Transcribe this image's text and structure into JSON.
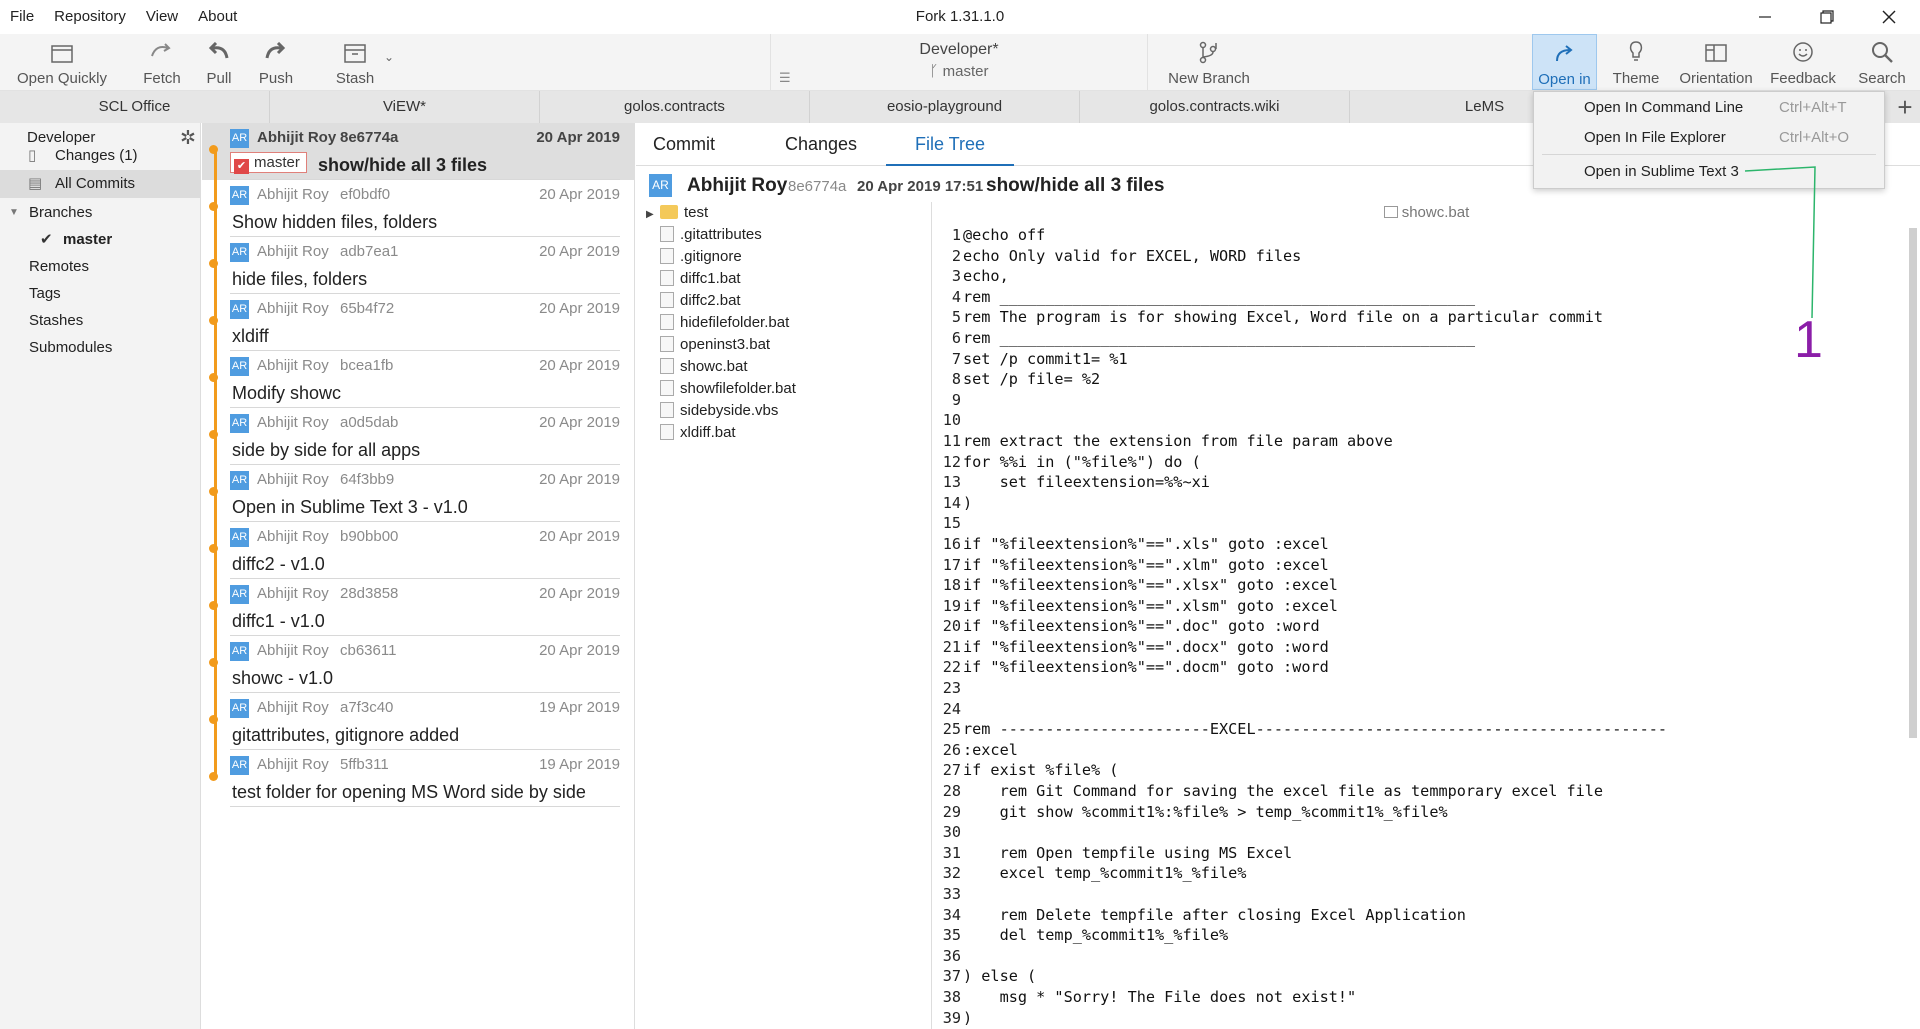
{
  "window": {
    "title": "Fork 1.31.1.0"
  },
  "menu": [
    "File",
    "Repository",
    "View",
    "About"
  ],
  "toolbar": {
    "open_quickly": "Open Quickly",
    "fetch": "Fetch",
    "pull": "Pull",
    "push": "Push",
    "stash": "Stash",
    "repo_name": "Developer*",
    "repo_branch": "master",
    "new_branch": "New Branch",
    "open_in": "Open in",
    "theme": "Theme",
    "orientation": "Orientation",
    "feedback": "Feedback",
    "search": "Search"
  },
  "repo_tabs": [
    "SCL Office",
    "ViEW*",
    "golos.contracts",
    "eosio-playground",
    "golos.contracts.wiki",
    "LeMS"
  ],
  "sidebar": {
    "title": "Developer",
    "changes": "Changes (1)",
    "all_commits": "All Commits",
    "branches": "Branches",
    "master": "master",
    "remotes": "Remotes",
    "tags": "Tags",
    "stashes": "Stashes",
    "submodules": "Submodules"
  },
  "commits": [
    {
      "avatar": "AR",
      "author": "Abhijit Roy",
      "hash": "8e6774a",
      "date": "20 Apr 2019",
      "message": "show/hide all 3 files",
      "branch": "master"
    },
    {
      "avatar": "AR",
      "author": "Abhijit Roy",
      "hash": "ef0bdf0",
      "date": "20 Apr 2019",
      "message": "Show hidden files, folders"
    },
    {
      "avatar": "AR",
      "author": "Abhijit Roy",
      "hash": "adb7ea1",
      "date": "20 Apr 2019",
      "message": "hide files, folders"
    },
    {
      "avatar": "AR",
      "author": "Abhijit Roy",
      "hash": "65b4f72",
      "date": "20 Apr 2019",
      "message": "xldiff"
    },
    {
      "avatar": "AR",
      "author": "Abhijit Roy",
      "hash": "bcea1fb",
      "date": "20 Apr 2019",
      "message": "Modify showc"
    },
    {
      "avatar": "AR",
      "author": "Abhijit Roy",
      "hash": "a0d5dab",
      "date": "20 Apr 2019",
      "message": "side by side for all apps"
    },
    {
      "avatar": "AR",
      "author": "Abhijit Roy",
      "hash": "64f3bb9",
      "date": "20 Apr 2019",
      "message": "Open in Sublime Text 3 - v1.0"
    },
    {
      "avatar": "AR",
      "author": "Abhijit Roy",
      "hash": "b90bb00",
      "date": "20 Apr 2019",
      "message": "diffc2 - v1.0"
    },
    {
      "avatar": "AR",
      "author": "Abhijit Roy",
      "hash": "28d3858",
      "date": "20 Apr 2019",
      "message": "diffc1 - v1.0"
    },
    {
      "avatar": "AR",
      "author": "Abhijit Roy",
      "hash": "cb63611",
      "date": "20 Apr 2019",
      "message": "showc - v1.0"
    },
    {
      "avatar": "AR",
      "author": "Abhijit Roy",
      "hash": "a7f3c40",
      "date": "19 Apr 2019",
      "message": "gitattributes, gitignore added"
    },
    {
      "avatar": "AR",
      "author": "Abhijit Roy",
      "hash": "5ffb311",
      "date": "19 Apr 2019",
      "message": "test folder for opening MS Word side by side"
    }
  ],
  "detail": {
    "tabs": [
      "Commit",
      "Changes",
      "File Tree"
    ],
    "active_tab": "File Tree",
    "avatar": "AR",
    "author": "Abhijit Roy",
    "hash": "8e6774a",
    "date": "20 Apr 2019 17:51",
    "subject": "show/hide all 3 files"
  },
  "file_tree": [
    {
      "name": "test",
      "type": "folder"
    },
    {
      "name": ".gitattributes",
      "type": "file"
    },
    {
      "name": ".gitignore",
      "type": "file"
    },
    {
      "name": "diffc1.bat",
      "type": "bat"
    },
    {
      "name": "diffc2.bat",
      "type": "bat"
    },
    {
      "name": "hidefilefolder.bat",
      "type": "bat"
    },
    {
      "name": "openinst3.bat",
      "type": "bat"
    },
    {
      "name": "showc.bat",
      "type": "bat"
    },
    {
      "name": "showfilefolder.bat",
      "type": "bat"
    },
    {
      "name": "sidebyside.vbs",
      "type": "vbs"
    },
    {
      "name": "xldiff.bat",
      "type": "bat"
    }
  ],
  "code": {
    "filename": "showc.bat",
    "lines": [
      "@echo off",
      "echo Only valid for EXCEL, WORD files",
      "echo,",
      "rem ____________________________________________________",
      "rem The program is for showing Excel, Word file on a particular commit",
      "rem ____________________________________________________",
      "set /p commit1= %1",
      "set /p file= %2",
      "",
      "",
      "rem extract the extension from file param above",
      "for %%i in (\"%file%\") do (",
      "    set fileextension=%%~xi",
      ")",
      "",
      "if \"%fileextension%\"==\".xls\" goto :excel",
      "if \"%fileextension%\"==\".xlm\" goto :excel",
      "if \"%fileextension%\"==\".xlsx\" goto :excel",
      "if \"%fileextension%\"==\".xlsm\" goto :excel",
      "if \"%fileextension%\"==\".doc\" goto :word",
      "if \"%fileextension%\"==\".docx\" goto :word",
      "if \"%fileextension%\"==\".docm\" goto :word",
      "",
      "",
      "rem -----------------------EXCEL---------------------------------------------",
      ":excel",
      "if exist %file% (",
      "    rem Git Command for saving the excel file as temmporary excel file",
      "    git show %commit1%:%file% > temp_%commit1%_%file%",
      "",
      "    rem Open tempfile using MS Excel",
      "    excel temp_%commit1%_%file%",
      "",
      "    rem Delete tempfile after closing Excel Application",
      "    del temp_%commit1%_%file%",
      "",
      ") else (",
      "    msg * \"Sorry! The File does not exist!\"",
      ")"
    ]
  },
  "open_in_menu": {
    "items": [
      {
        "label": "Open In Command Line",
        "shortcut": "Ctrl+Alt+T"
      },
      {
        "label": "Open In File Explorer",
        "shortcut": "Ctrl+Alt+O"
      },
      {
        "label": "Open in Sublime Text 3",
        "shortcut": ""
      }
    ]
  },
  "annotation": {
    "number": "1"
  },
  "colors": {
    "accent": "#1f6fb8",
    "graph": "#f29b1c",
    "avatar": "#4f9ce0",
    "annotation": "#8b1ea8",
    "annotation_line": "#2cb56b"
  }
}
